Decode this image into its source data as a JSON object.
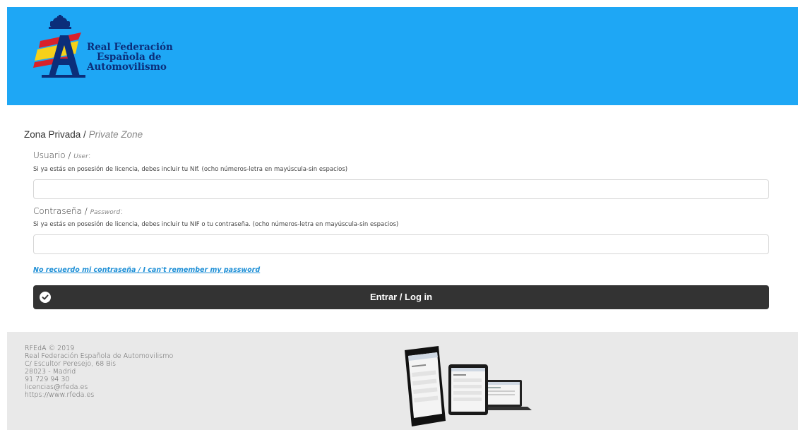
{
  "brand": {
    "line1": "Real Federación",
    "line2": "Española de",
    "line3": "Automovilismo",
    "header_color": "#1ea7f5",
    "logo_colors": {
      "red": "#d9202a",
      "yellow": "#f6d11a",
      "blue": "#0b2e7a"
    }
  },
  "login": {
    "title_es": "Zona Privada",
    "title_sep": " / ",
    "title_en": "Private Zone",
    "user_label_es": "Usuario / ",
    "user_label_en": "User",
    "user_label_colon": ":",
    "user_hint": "Si ya estás en posesión de licencia, debes incluir tu NIf. (ocho números-letra en mayúscula-sin espacios)",
    "user_value": "",
    "password_label_es": "Contraseña / ",
    "password_label_en": "Password",
    "password_label_colon": ":",
    "password_hint": "Si ya estás en posesión de licencia, debes incluir tu NIF o tu contraseña. (ocho números-letra en mayúscula-sin espacios)",
    "password_value": "",
    "forgot_link": "No recuerdo mi contraseña / I can't remember my password",
    "submit_label": "Entrar / Log in",
    "button_color": "#333333",
    "link_color": "#1e8fd6"
  },
  "footer": {
    "lines": [
      "RFEdA © 2019",
      "Real Federación Española de Automovilismo",
      "C/ Escultor Peresejo, 68 Bis",
      "28023 - Madrid",
      "91 729 94 30",
      "licencias@rfeda.es",
      "https://www.rfeda.es"
    ],
    "background": "#e9e9e9"
  }
}
